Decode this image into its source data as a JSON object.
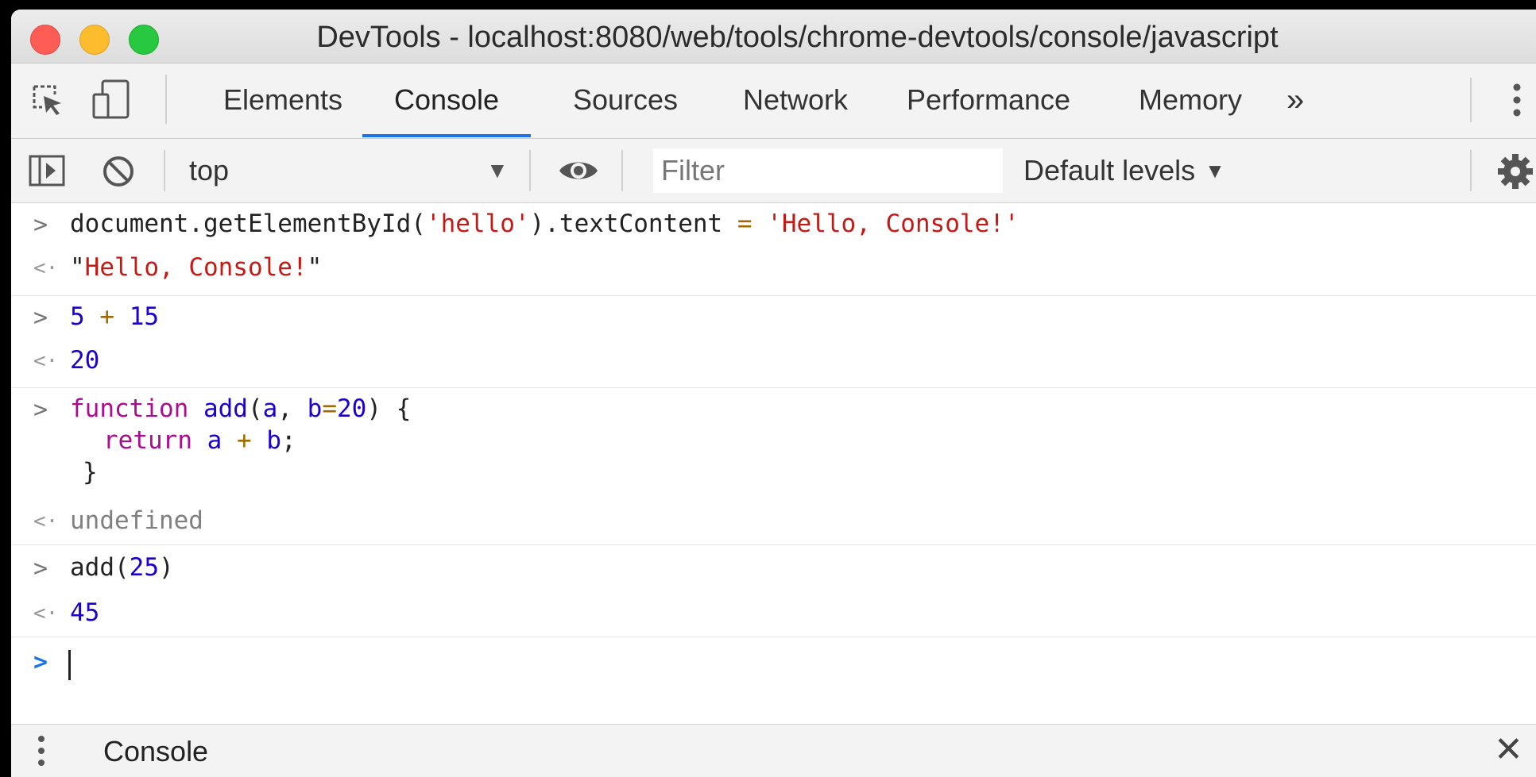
{
  "window": {
    "title": "DevTools - localhost:8080/web/tools/chrome-devtools/console/javascript"
  },
  "toolbar": {
    "icons": [
      "inspect-element-icon",
      "device-toolbar-icon",
      "more-options-icon"
    ],
    "tabs": [
      {
        "label": "Elements",
        "active": false
      },
      {
        "label": "Console",
        "active": true
      },
      {
        "label": "Sources",
        "active": false
      },
      {
        "label": "Network",
        "active": false
      },
      {
        "label": "Performance",
        "active": false
      },
      {
        "label": "Memory",
        "active": false
      }
    ],
    "more_tabs_label": "»"
  },
  "console_toolbar": {
    "icons": [
      "show-sidebar-icon",
      "clear-console-icon",
      "live-expression-eye-icon",
      "settings-gear-icon"
    ],
    "context": "top",
    "context_arrow": "▼",
    "filter_placeholder": "Filter",
    "levels_label": "Default levels",
    "levels_caret": "▼"
  },
  "console": {
    "input_prompt": ">",
    "output_prompt": "<·",
    "entries": [
      {
        "input": {
          "t1": "document.getElementById(",
          "t2": "'hello'",
          "t3": ").textContent ",
          "t4": "=",
          "t5": " ",
          "t6": "'Hello, Console!'"
        },
        "output": {
          "q1": "\"",
          "s": "Hello, Console!",
          "q2": "\""
        }
      },
      {
        "input": {
          "a": "5",
          "op": "+",
          "b": "15"
        },
        "output": {
          "value": "20"
        }
      },
      {
        "input": {
          "line1": {
            "kw": "function",
            "name": "add",
            "p1": "(",
            "a": "a",
            "comma": ", ",
            "b": "b",
            "eq": "=",
            "def": "20",
            "p2": ") {"
          },
          "line2": {
            "kw": "return",
            "a": "a",
            "op": "+",
            "b": "b",
            "semi": ";"
          },
          "line3": "}"
        },
        "output": {
          "value": "undefined"
        }
      },
      {
        "input": {
          "fn": "add(",
          "arg": "25",
          "close": ")"
        },
        "output": {
          "value": "45"
        }
      }
    ]
  },
  "drawer": {
    "title": "Console",
    "menu_icon": "vertical-dots-icon",
    "close_label": "✕"
  }
}
